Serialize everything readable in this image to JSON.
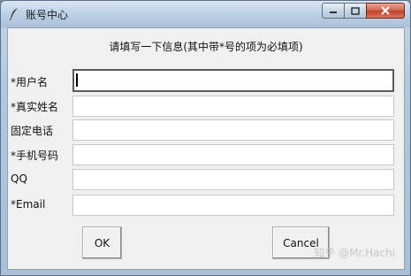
{
  "window": {
    "title": "账号中心",
    "icon": "feather-icon",
    "controls": {
      "minimize": "minimize-icon",
      "maximize": "maximize-icon",
      "close": "close-icon"
    }
  },
  "form": {
    "header": "请填写一下信息(其中带*号的项为必填项)",
    "fields": [
      {
        "label": "*用户名",
        "value": ""
      },
      {
        "label": "*真实姓名",
        "value": ""
      },
      {
        "label": "固定电话",
        "value": ""
      },
      {
        "label": "*手机号码",
        "value": ""
      },
      {
        "label": "QQ",
        "value": ""
      },
      {
        "label": "*Email",
        "value": ""
      }
    ]
  },
  "buttons": {
    "ok": "OK",
    "cancel": "Cancel"
  },
  "watermark": "知乎 @Mr.Hachi"
}
